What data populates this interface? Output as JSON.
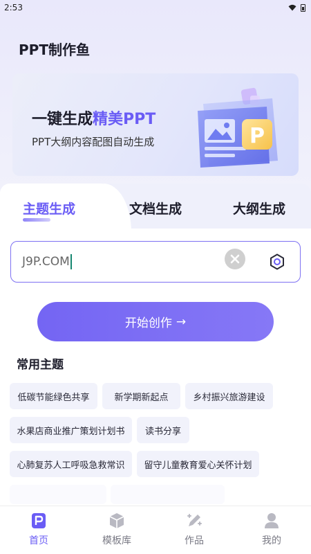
{
  "status_bar": {
    "time": "2:53",
    "icons": [
      "wifi-icon",
      "battery-icon"
    ]
  },
  "app_title": "PPT制作鱼",
  "banner": {
    "title_plain": "一键生成",
    "title_accent": "精美PPT",
    "subtitle": "PPT大纲内容配图自动生成",
    "art_letter": "P"
  },
  "tabs": [
    {
      "label": "主题生成",
      "active": true
    },
    {
      "label": "文档生成",
      "active": false
    },
    {
      "label": "大纲生成",
      "active": false
    }
  ],
  "input": {
    "value": "J9P.COM"
  },
  "start_button": {
    "label": "开始创作",
    "arrow": "→"
  },
  "topics": {
    "title": "常用主题",
    "chips": [
      "低碳节能绿色共享",
      "新学期新起点",
      "乡村振兴旅游建设",
      "水果店商业推广策划计划书",
      "读书分享",
      "心肺复苏人工呼吸急救常识",
      "留守儿童教育爱心关怀计划"
    ]
  },
  "bottom_nav": [
    {
      "label": "首页",
      "icon": "home-icon",
      "active": true
    },
    {
      "label": "模板库",
      "icon": "template-box-icon",
      "active": false
    },
    {
      "label": "作品",
      "icon": "works-pencil-icon",
      "active": false
    },
    {
      "label": "我的",
      "icon": "profile-icon",
      "active": false
    }
  ],
  "colors": {
    "accent": "#6a5cf5",
    "chip_bg": "#f1f2fb",
    "input_border": "#7d70f2"
  }
}
